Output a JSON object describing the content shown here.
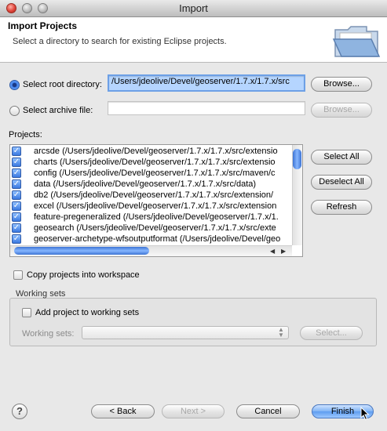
{
  "window": {
    "title": "Import"
  },
  "header": {
    "title": "Import Projects",
    "description": "Select a directory to search for existing Eclipse projects."
  },
  "source": {
    "root_label": "Select root directory:",
    "root_value": "/Users/jdeolive/Devel/geoserver/1.7.x/1.7.x/src",
    "root_selected": true,
    "archive_label": "Select archive file:",
    "archive_value": "",
    "browse_label": "Browse..."
  },
  "projects": {
    "label": "Projects:",
    "items": [
      {
        "checked": true,
        "text": "arcsde (/Users/jdeolive/Devel/geoserver/1.7.x/1.7.x/src/extensio"
      },
      {
        "checked": true,
        "text": "charts (/Users/jdeolive/Devel/geoserver/1.7.x/1.7.x/src/extensio"
      },
      {
        "checked": true,
        "text": "config (/Users/jdeolive/Devel/geoserver/1.7.x/1.7.x/src/maven/c"
      },
      {
        "checked": true,
        "text": "data (/Users/jdeolive/Devel/geoserver/1.7.x/1.7.x/src/data)"
      },
      {
        "checked": true,
        "text": "db2 (/Users/jdeolive/Devel/geoserver/1.7.x/1.7.x/src/extension/"
      },
      {
        "checked": true,
        "text": "excel (/Users/jdeolive/Devel/geoserver/1.7.x/1.7.x/src/extension"
      },
      {
        "checked": true,
        "text": "feature-pregeneralized (/Users/jdeolive/Devel/geoserver/1.7.x/1."
      },
      {
        "checked": true,
        "text": "geosearch (/Users/jdeolive/Devel/geoserver/1.7.x/1.7.x/src/exte"
      },
      {
        "checked": true,
        "text": "geoserver-archetype-wfsoutputformat (/Users/jdeolive/Devel/geo"
      }
    ],
    "select_all": "Select All",
    "deselect_all": "Deselect All",
    "refresh": "Refresh"
  },
  "options": {
    "copy_label": "Copy projects into workspace"
  },
  "working_sets": {
    "group_title": "Working sets",
    "add_label": "Add project to working sets",
    "sets_label": "Working sets:",
    "select_label": "Select..."
  },
  "footer": {
    "back": "< Back",
    "next": "Next >",
    "cancel": "Cancel",
    "finish": "Finish",
    "help": "?"
  }
}
